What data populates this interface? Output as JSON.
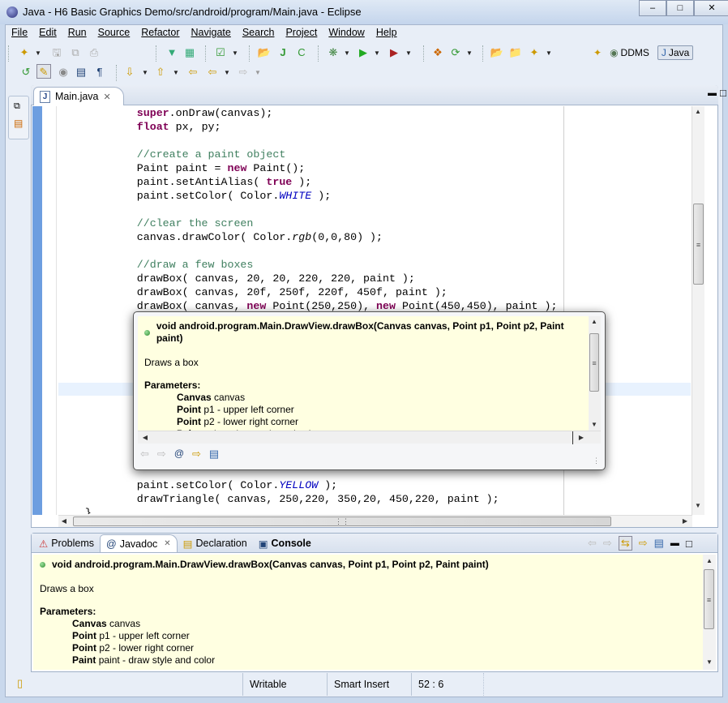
{
  "window": {
    "title": "Java - H6 Basic Graphics Demo/src/android/program/Main.java - Eclipse",
    "controls": [
      "minimize",
      "maximize",
      "close"
    ]
  },
  "menu": [
    {
      "label": "File"
    },
    {
      "label": "Edit"
    },
    {
      "label": "Run"
    },
    {
      "label": "Source"
    },
    {
      "label": "Refactor"
    },
    {
      "label": "Navigate"
    },
    {
      "label": "Search"
    },
    {
      "label": "Project"
    },
    {
      "label": "Window"
    },
    {
      "label": "Help"
    }
  ],
  "perspectives": {
    "ddms": "DDMS",
    "java": "Java",
    "active": "Java"
  },
  "editor": {
    "tab": "Main.java",
    "lines": [
      [
        [
          "kw",
          "super"
        ],
        [
          "",
          "."
        ],
        [
          "",
          "onDraw(canvas);"
        ]
      ],
      [
        [
          "kw",
          "float"
        ],
        [
          "",
          " px, py;"
        ]
      ],
      [],
      [
        [
          "cm",
          "//create a paint object"
        ]
      ],
      [
        [
          "",
          "Paint paint = "
        ],
        [
          "kw",
          "new"
        ],
        [
          "",
          " Paint();"
        ]
      ],
      [
        [
          "",
          "paint.setAntiAlias( "
        ],
        [
          "kw",
          "true"
        ],
        [
          "",
          " );"
        ]
      ],
      [
        [
          "",
          "paint.setColor( Color."
        ],
        [
          "cs",
          "WHITE"
        ],
        [
          "",
          " );"
        ]
      ],
      [],
      [
        [
          "cm",
          "//clear the screen"
        ]
      ],
      [
        [
          "",
          "canvas.drawColor( Color."
        ],
        [
          "it",
          "rgb"
        ],
        [
          "",
          "(0,0,80) );"
        ]
      ],
      [],
      [
        [
          "cm",
          "//draw a few boxes"
        ]
      ],
      [
        [
          "",
          "drawBox( canvas, 20, 20, 220, 220, paint );"
        ]
      ],
      [
        [
          "",
          "drawBox( canvas, 20f, 250f, 220f, 450f, paint );"
        ]
      ],
      [
        [
          "",
          "drawBox( canvas, "
        ],
        [
          "kw",
          "new"
        ],
        [
          "",
          " Point(250,250), "
        ],
        [
          "kw",
          "new"
        ],
        [
          "",
          " Point(450,450), paint );"
        ]
      ],
      [],
      [],
      [],
      [],
      [],
      [],
      [],
      [],
      [],
      [],
      [],
      [],
      [
        [
          "",
          "paint.setColor( Color."
        ],
        [
          "cs",
          "YELLOW"
        ],
        [
          "",
          " );"
        ]
      ],
      [
        [
          "",
          "drawTriangle( canvas, 250,220, 350,20, 450,220, paint );"
        ]
      ],
      [
        [
          "",
          "    }"
        ]
      ]
    ]
  },
  "javadoc": {
    "signature": "void android.program.Main.DrawView.drawBox(Canvas canvas, Point p1, Point p2, Paint paint)",
    "description": "Draws a box",
    "params_label": "Parameters:",
    "params": [
      {
        "type": "Canvas",
        "desc": "canvas"
      },
      {
        "type": "Point",
        "desc": "p1 - upper left corner"
      },
      {
        "type": "Point",
        "desc": "p2 - lower right corner"
      },
      {
        "type": "Paint",
        "desc": "paint - draw style and color"
      }
    ]
  },
  "bottom_tabs": [
    {
      "label": "Problems"
    },
    {
      "label": "Javadoc",
      "active": true
    },
    {
      "label": "Declaration"
    },
    {
      "label": "Console"
    }
  ],
  "status": {
    "writable": "Writable",
    "insert_mode": "Smart Insert",
    "position": "52 : 6"
  },
  "colors": {
    "keyword": "#7f0055",
    "comment": "#3f7f5f",
    "constant": "#0000c0",
    "javadoc_bg": "#ffffe1",
    "ruler": "#6d9ee0"
  }
}
